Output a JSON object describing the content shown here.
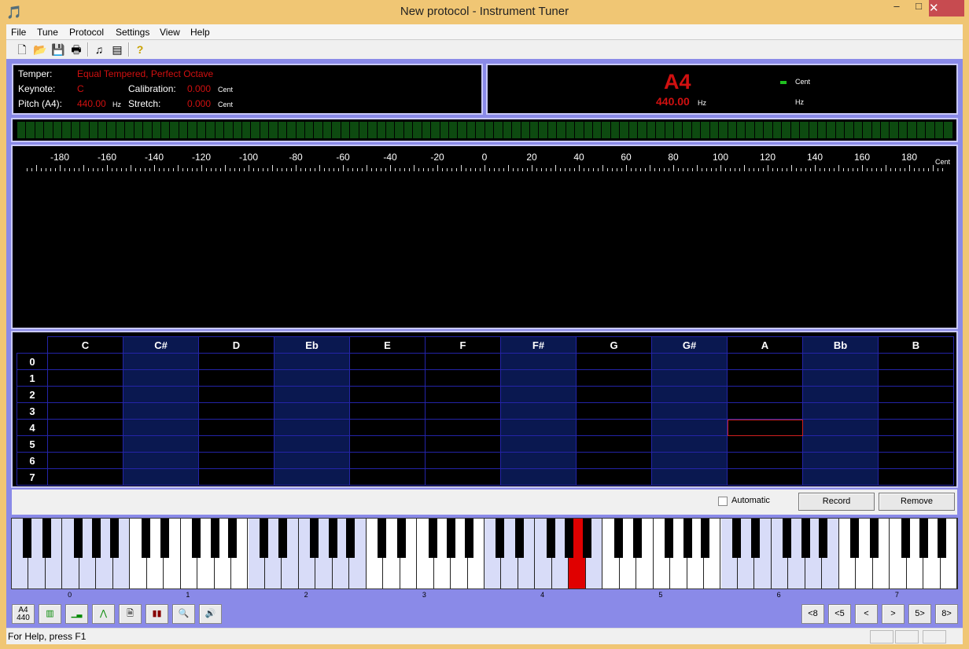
{
  "window": {
    "title": "New protocol - Instrument Tuner",
    "minimize": "–",
    "maximize": "□",
    "close": "✕"
  },
  "menu": [
    "File",
    "Tune",
    "Protocol",
    "Settings",
    "View",
    "Help"
  ],
  "toolbar": [
    "new-file",
    "open-folder",
    "save",
    "print",
    "tuner",
    "properties",
    "help"
  ],
  "info": {
    "temper_label": "Temper:",
    "temper": "Equal Tempered, Perfect Octave",
    "keynote_label": "Keynote:",
    "keynote": "C",
    "pitch_label": "Pitch (A4):",
    "pitch": "440.00",
    "pitch_unit": "Hz",
    "calibration_label": "Calibration:",
    "calibration": "0.000",
    "calibration_unit": "Cent",
    "stretch_label": "Stretch:",
    "stretch": "0.000",
    "stretch_unit": "Cent"
  },
  "display": {
    "note": "A4",
    "freq": "440.00",
    "freq_unit": "Hz",
    "cent_unit": "Cent",
    "hz_unit": "Hz",
    "indicator_color": "#20c020"
  },
  "ruler": {
    "labels": [
      "-180",
      "-160",
      "-140",
      "-120",
      "-100",
      "-80",
      "-60",
      "-40",
      "-20",
      "0",
      "20",
      "40",
      "60",
      "80",
      "100",
      "120",
      "140",
      "160",
      "180"
    ],
    "unit": "Cent"
  },
  "grid": {
    "columns": [
      "C",
      "C#",
      "D",
      "Eb",
      "E",
      "F",
      "F#",
      "G",
      "G#",
      "A",
      "Bb",
      "B"
    ],
    "rows": [
      "0",
      "1",
      "2",
      "3",
      "4",
      "5",
      "6",
      "7"
    ],
    "selected": {
      "row": "4",
      "column": "A"
    }
  },
  "controls": {
    "automatic_label": "Automatic",
    "automatic": false,
    "record": "Record",
    "remove": "Remove"
  },
  "piano": {
    "octaves": [
      "0",
      "1",
      "2",
      "3",
      "4",
      "5",
      "6",
      "7"
    ],
    "active_key": "A4",
    "active_color": "#e00000"
  },
  "bottom_tools": {
    "a4": "A4\n440",
    "nav": [
      "<8",
      "<5",
      "<",
      ">",
      "5>",
      "8>"
    ]
  },
  "status": {
    "text": "For Help, press F1"
  }
}
